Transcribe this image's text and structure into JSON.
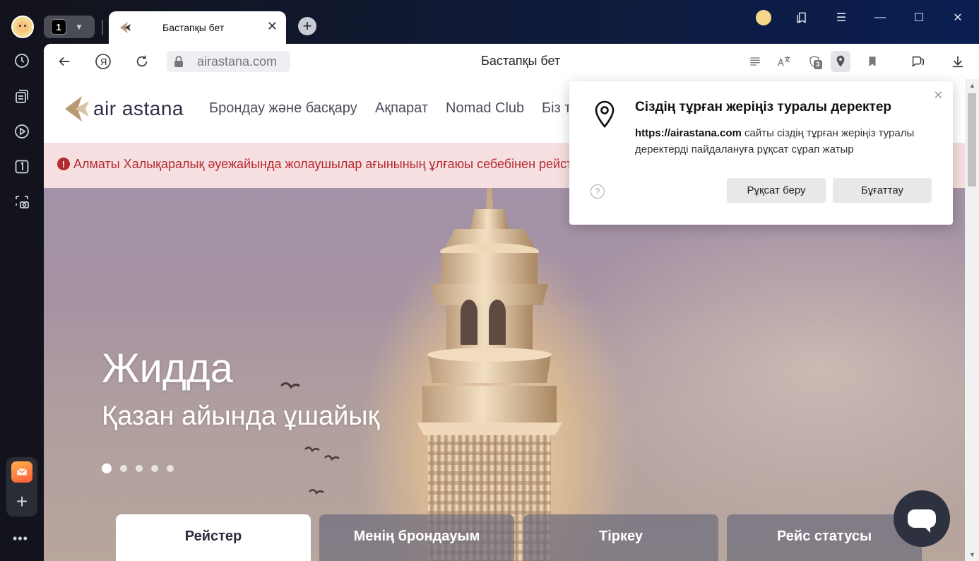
{
  "browser": {
    "tab_count": "1",
    "tab_title": "Бастапқы бет",
    "url": "airastana.com",
    "page_title": "Бастапқы бет",
    "protect_badge": "3"
  },
  "site": {
    "logo_text": "air astana",
    "nav": [
      "Брондау және басқару",
      "Ақпарат",
      "Nomad Club",
      "Біз т"
    ],
    "alert": "Алматы Халықаралық әуежайында жолаушылар ағынының ұлғаюы себебінен рейстер",
    "hero_title": "Жидда",
    "hero_subtitle": "Қазан айында ұшайық",
    "slides_total": 5,
    "slides_active": 1,
    "tabs": [
      "Рейстер",
      "Менің брондауым",
      "Тіркеу",
      "Рейс статусы"
    ]
  },
  "popup": {
    "heading": "Сіздің тұрған жеріңіз туралы деректер",
    "site": "https://airastana.com",
    "message": " сайты сіздің тұрған жеріңіз туралы деректерді пайдалануға рұқсат сұрап жатыр",
    "allow_label": "Рұқсат беру",
    "block_label": "Бұғаттау",
    "help_label": "?"
  },
  "colors": {
    "brand_gold": "#b79a74",
    "brand_navy": "#2e2f45",
    "alert_red": "#b52a31",
    "alert_bg": "#f6dfe0"
  }
}
